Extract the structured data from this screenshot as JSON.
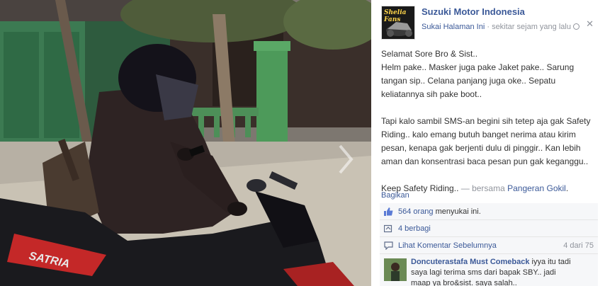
{
  "page": {
    "name": "Suzuki Motor Indonesia",
    "like_link": "Sukai Halaman Ini",
    "separator": " · ",
    "time": "sekitar sejam yang lalu",
    "avatar_text": "Shelia Fans"
  },
  "post": {
    "paragraph1": "Selamat Sore Bro & Sist..",
    "paragraph2": "Helm pake.. Masker juga pake Jaket pake.. Sarung tangan sip.. Celana panjang juga oke.. Sepatu keliatannya sih pake boot..",
    "paragraph3": "Tapi kalo sambil SMS-an begini sih tetep aja gak Safety Riding.. kalo emang butuh banget nerima atau kirim pesan, kenapa gak berjenti dulu di pinggir.. Kan lebih aman dan konsentrasi baca pesan pun gak keganggu..",
    "closing": "Keep Safety Riding..",
    "with_text": " — bersama ",
    "tagged": "Pangeran Gokil",
    "end": "."
  },
  "actions": {
    "share": "Bagikan"
  },
  "ufi": {
    "likes_count": "564 orang",
    "likes_suffix": " menyukai ini.",
    "shares": "4 berbagi",
    "previous_comments": "Lihat Komentar Sebelumnya",
    "comment_counter": "4 dari 75"
  },
  "comment": {
    "author": "Doncuterastafa Must Comeback",
    "text": " iyya itu tadi saya lagi terima sms dari bapak SBY.. jadi maap ya bro&sist. saya salah.."
  },
  "icons": {
    "close": "close-icon",
    "like": "thumbs-up-icon",
    "share": "share-icon",
    "comment": "comment-icon",
    "next": "chevron-right-icon",
    "audience": "globe-icon"
  },
  "colors": {
    "link": "#3b5998",
    "muted": "#90949c",
    "ufi_bg": "#f6f7f9"
  }
}
